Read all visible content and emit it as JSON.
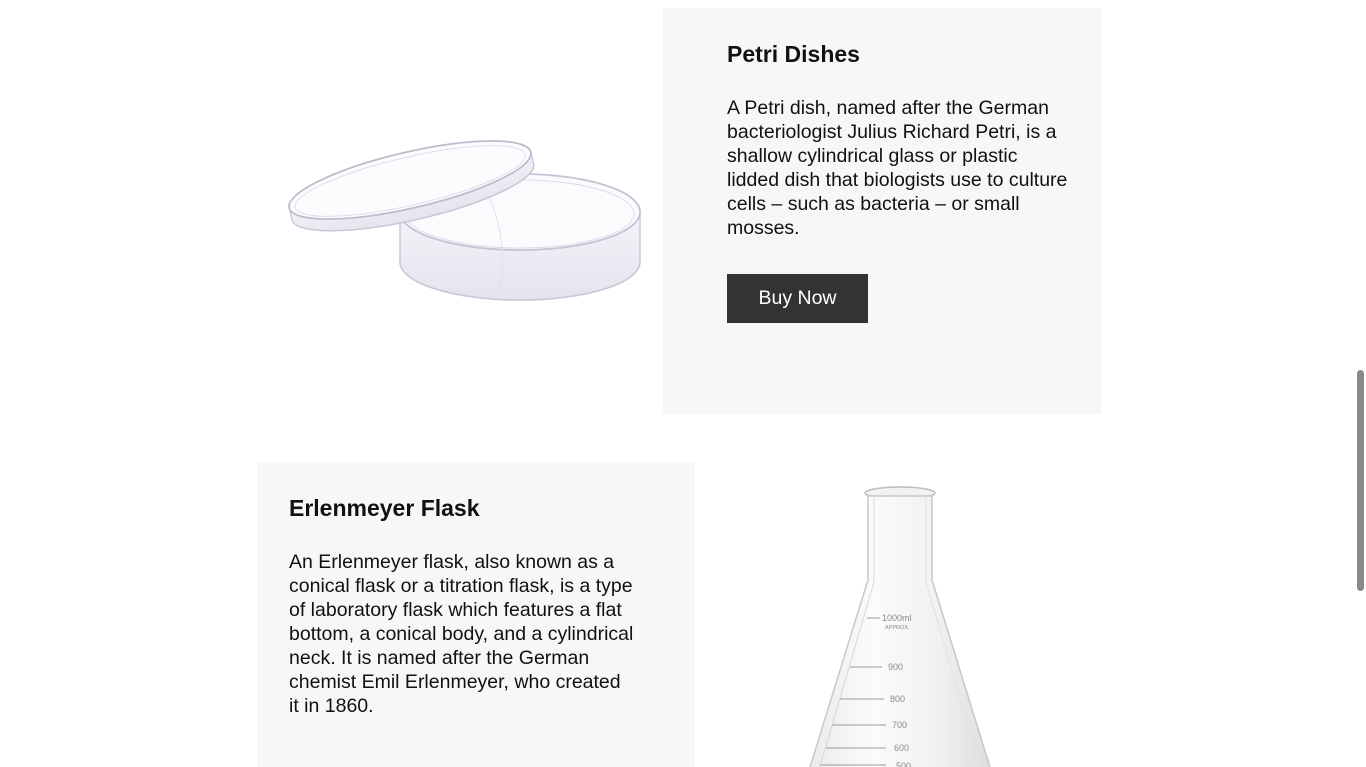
{
  "products": [
    {
      "title": "Petri Dishes",
      "description": "A Petri dish, named after the German bacteriologist Julius Richard Petri, is a shallow cylindrical glass or plastic lidded dish that biologists use to culture cells – such as bacteria – or small mosses.",
      "button_label": "Buy Now",
      "image_icon": "petri-dish-image"
    },
    {
      "title": "Erlenmeyer Flask",
      "description": "An Erlenmeyer flask, also known as a conical flask or a titration flask, is a type of laboratory flask which features a flat bottom, a conical body, and a cylindrical neck. It is named after the German chemist Emil Erlenmeyer, who created it in 1860.",
      "image_icon": "erlenmeyer-flask-image",
      "flask_markings": {
        "capacity": "1000ml",
        "approx": "APPROX.",
        "graduations": [
          "900",
          "800",
          "700",
          "600",
          "500"
        ]
      }
    }
  ],
  "colors": {
    "card_background": "#f7f7f7",
    "button_background": "#333333",
    "button_text": "#ffffff"
  }
}
